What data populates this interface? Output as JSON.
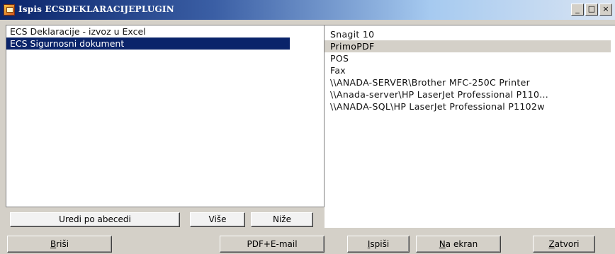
{
  "window": {
    "title": "Ispis ECSDEKLARACIJEPLUGIN",
    "minimize_label": "_",
    "maximize_label": "□",
    "close_label": "×"
  },
  "reports": {
    "items": [
      {
        "label": "ECS Deklaracije - izvoz u Excel",
        "selected": false
      },
      {
        "label": "ECS Sigurnosni dokument",
        "selected": true
      }
    ]
  },
  "printers": {
    "items": [
      {
        "label": "Snagit 10",
        "selected": false
      },
      {
        "label": "PrimoPDF",
        "selected": true
      },
      {
        "label": "POS",
        "selected": false
      },
      {
        "label": "Fax",
        "selected": false
      },
      {
        "label": "\\\\ANADA-SERVER\\Brother MFC-250C Printer",
        "selected": false
      },
      {
        "label": "\\\\Anada-server\\HP LaserJet Professional P110...",
        "selected": false
      },
      {
        "label": "\\\\ANADA-SQL\\HP LaserJet Professional P1102w",
        "selected": false
      }
    ]
  },
  "list_buttons": {
    "sort_label": "Uredi po abecedi",
    "up_label": "Više",
    "down_label": "Niže"
  },
  "footer_buttons": {
    "delete": {
      "accel": "B",
      "rest": "riši"
    },
    "pdf_email_label": "PDF+E-mail",
    "print": {
      "accel": "I",
      "rest": "spiši"
    },
    "screen": {
      "accel": "N",
      "rest": "a ekran"
    },
    "close": {
      "accel": "Z",
      "rest": "atvori"
    }
  },
  "colors": {
    "title_gradient_start": "#0a246a",
    "selection": "#0a246a",
    "face": "#d4d0c8"
  }
}
